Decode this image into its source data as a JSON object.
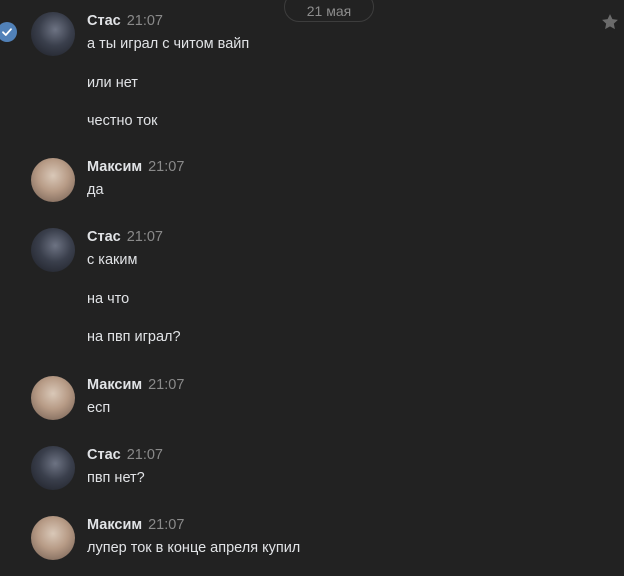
{
  "date_divider": "21 мая",
  "icons": {
    "select": "check-icon",
    "favorite": "star-icon",
    "accent": "#5181b8"
  },
  "groups": [
    {
      "author": "Стас",
      "time": "21:07",
      "avatar": "avatar-stas",
      "messages": [
        "а ты играл с читом вайп",
        "или нет",
        "честно ток"
      ]
    },
    {
      "author": "Максим",
      "time": "21:07",
      "avatar": "avatar-maxim",
      "messages": [
        "да"
      ]
    },
    {
      "author": "Стас",
      "time": "21:07",
      "avatar": "avatar-stas",
      "messages": [
        "с каким",
        "на что",
        "на пвп играл?"
      ]
    },
    {
      "author": "Максим",
      "time": "21:07",
      "avatar": "avatar-maxim",
      "messages": [
        "есп"
      ]
    },
    {
      "author": "Стас",
      "time": "21:07",
      "avatar": "avatar-stas",
      "messages": [
        "пвп нет?"
      ]
    },
    {
      "author": "Максим",
      "time": "21:07",
      "avatar": "avatar-maxim",
      "messages": [
        "лупер ток в конце апреля купил"
      ]
    }
  ]
}
